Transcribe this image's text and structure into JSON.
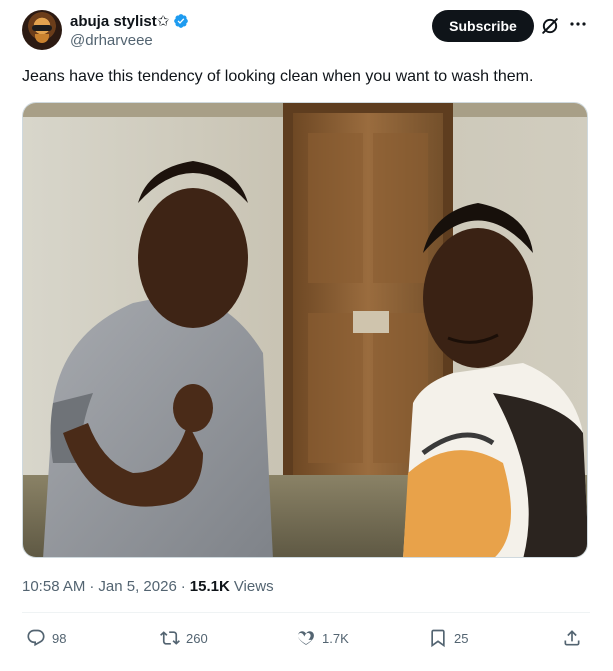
{
  "tweet": {
    "author": {
      "display_name": "abuja stylist✩",
      "handle": "@drharveee",
      "verified": true
    },
    "subscribe_label": "Subscribe",
    "text": "Jeans have this tendency of looking clean when you want to wash them.",
    "timestamp": "10:58 AM",
    "separator": "·",
    "date": "Jan 5, 2026",
    "views_count": "15.1K",
    "views_label": "Views",
    "actions": {
      "replies": "98",
      "reposts": "260",
      "likes": "1.7K",
      "bookmarks": "25"
    }
  },
  "colors": {
    "text": "#0f1419",
    "secondary": "#536471",
    "verified_blue": "#1d9bf0",
    "subscribe_bg": "#0f1419"
  },
  "icons": [
    "verified-badge-icon",
    "grok-icon",
    "more-icon",
    "reply-icon",
    "repost-icon",
    "like-icon",
    "bookmark-icon",
    "share-icon"
  ]
}
